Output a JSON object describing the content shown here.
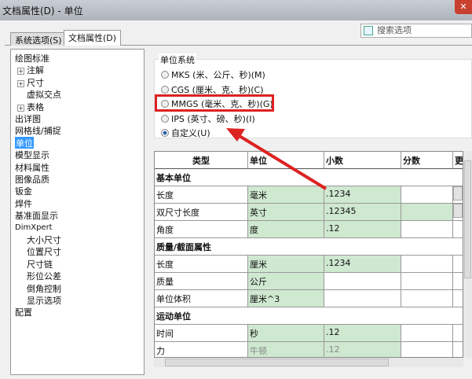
{
  "window": {
    "title": "文档属性(D) - 单位",
    "close": "✕"
  },
  "search": {
    "placeholder": "搜索选项"
  },
  "tabs": [
    {
      "label": "系统选项(S)"
    },
    {
      "label": "文档属性(D)"
    }
  ],
  "tree": [
    {
      "label": "绘图标准"
    },
    {
      "label": "注解",
      "expand": "+"
    },
    {
      "label": "尺寸",
      "expand": "+"
    },
    {
      "label": "虚拟交点"
    },
    {
      "label": "表格",
      "expand": "+"
    },
    {
      "label": "出详图"
    },
    {
      "label": "网格线/捕捉"
    },
    {
      "label": "单位"
    },
    {
      "label": "模型显示"
    },
    {
      "label": "材料属性"
    },
    {
      "label": "图像品质"
    },
    {
      "label": "钣金"
    },
    {
      "label": "焊件"
    },
    {
      "label": "基准面显示"
    },
    {
      "label": "DimXpert"
    },
    {
      "label": "大小尺寸"
    },
    {
      "label": "位置尺寸"
    },
    {
      "label": "尺寸链"
    },
    {
      "label": "形位公差"
    },
    {
      "label": "倒角控制"
    },
    {
      "label": "显示选项"
    },
    {
      "label": "配置"
    }
  ],
  "unit_system": {
    "label": "单位系统",
    "options": [
      {
        "label": "MKS (米、公斤、秒)(M)"
      },
      {
        "label": "CGS (厘米、克、秒)(C)"
      },
      {
        "label": "MMGS (毫米、克、秒)(G)"
      },
      {
        "label": "IPS (英寸、磅、秒)(I)"
      },
      {
        "label": "自定义(U)",
        "selected": true
      }
    ]
  },
  "table": {
    "headers": [
      "类型",
      "单位",
      "小数",
      "分数",
      "更"
    ],
    "rows": [
      {
        "section": "基本单位"
      },
      {
        "cells": [
          "长度",
          "毫米",
          ".1234",
          ""
        ]
      },
      {
        "cells": [
          "双尺寸长度",
          "英寸",
          ".12345",
          ""
        ]
      },
      {
        "cells": [
          "角度",
          "度",
          ".12",
          ""
        ]
      },
      {
        "section": "质量/截面属性"
      },
      {
        "cells": [
          "长度",
          "厘米",
          ".1234",
          ""
        ]
      },
      {
        "cells": [
          "质量",
          "公斤",
          "",
          ""
        ]
      },
      {
        "cells": [
          "单位体积",
          "厘米^3",
          "",
          ""
        ]
      },
      {
        "section": "运动单位"
      },
      {
        "cells": [
          "时间",
          "秒",
          ".12",
          ""
        ]
      },
      {
        "cells": [
          "力",
          "牛顿",
          ".12",
          ""
        ]
      }
    ]
  },
  "colors": {
    "highlight": "#dd2222",
    "green": "#cfe8d0",
    "selection": "#3399ff"
  }
}
